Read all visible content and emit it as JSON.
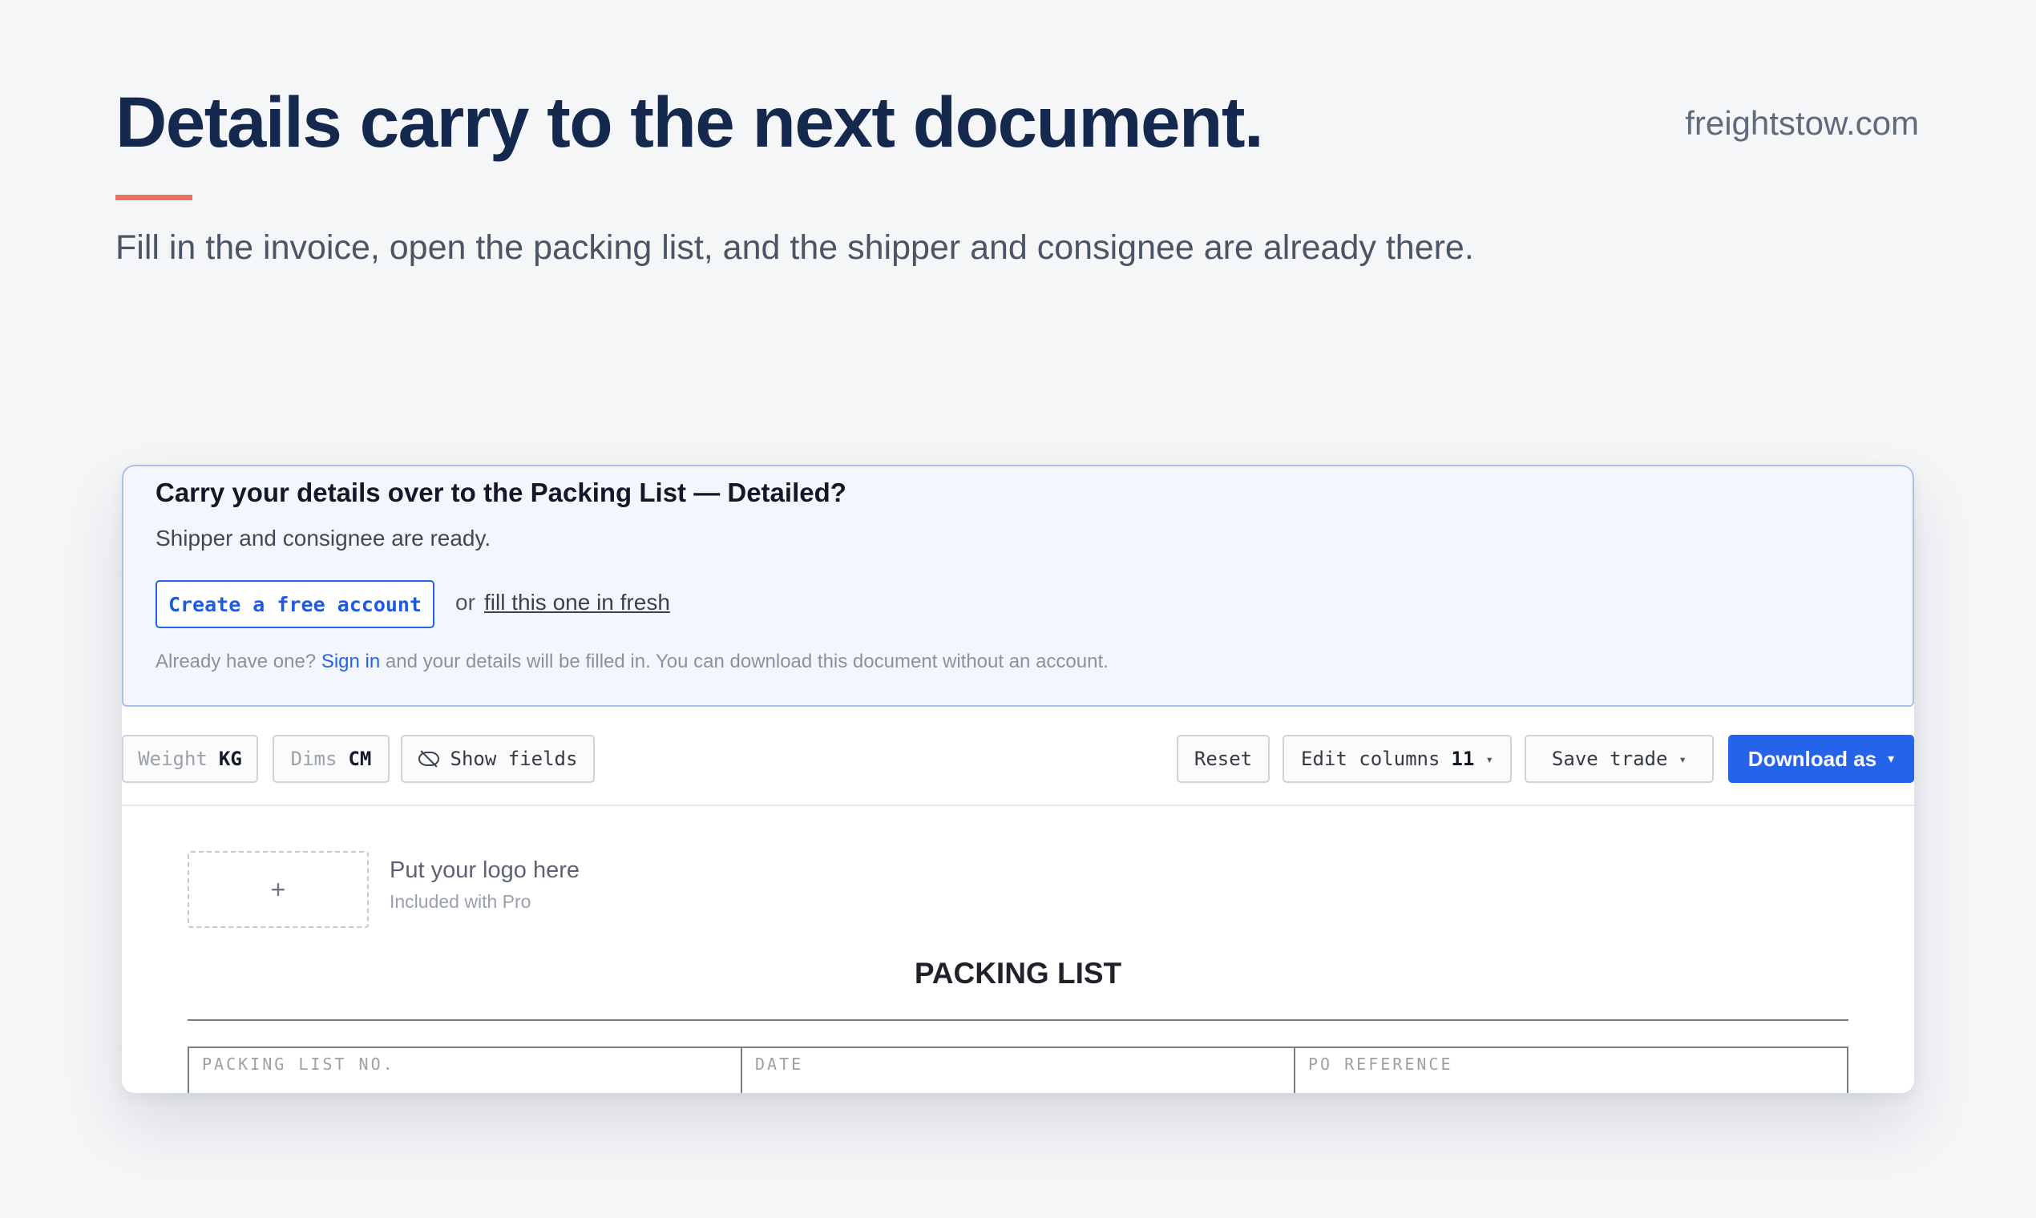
{
  "header": {
    "headline": "Details carry to the next document.",
    "site": "freightstow.com",
    "subhead": "Fill in the invoice, open the packing list, and the shipper and consignee are already there."
  },
  "banner": {
    "title": "Carry your details over to the Packing List — Detailed?",
    "subtitle": "Shipper and consignee are ready.",
    "create_button": "Create a free account",
    "or_text": "or",
    "fresh_link": "fill this one in fresh",
    "fineprint_before": "Already have one?",
    "signin_link": "Sign in",
    "fineprint_after": "and your details will be filled in. You can download this document without an account."
  },
  "toolbar": {
    "weight_label": "Weight",
    "weight_unit": "KG",
    "dims_label": "Dims",
    "dims_unit": "CM",
    "show_fields": "Show fields",
    "reset": "Reset",
    "edit_columns": "Edit columns",
    "edit_columns_count": "11",
    "save_trade": "Save trade",
    "download": "Download as",
    "caret": "▾"
  },
  "document": {
    "logo_plus": "+",
    "logo_title": "Put your logo here",
    "logo_sub": "Included with Pro",
    "title": "PACKING LIST",
    "fields": [
      "PACKING LIST NO.",
      "DATE",
      "PO REFERENCE"
    ]
  },
  "colors": {
    "headline": "#14294d",
    "accent": "#e9725f",
    "primary": "#2563eb",
    "banner_bg": "#f3f7fd",
    "banner_border": "#a8c1ea"
  },
  "icons": {
    "show_fields": "eye-off-icon",
    "dropdown": "chevron-down-icon",
    "logo_add": "plus-icon"
  }
}
